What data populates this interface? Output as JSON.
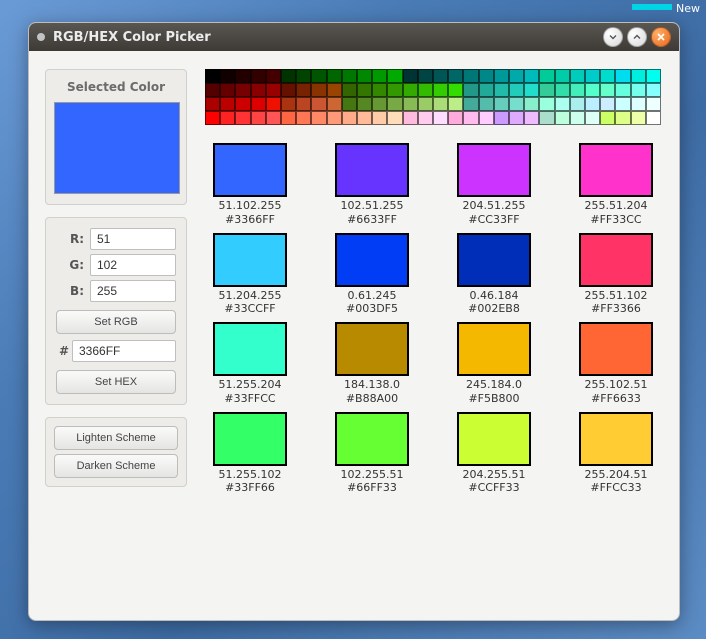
{
  "desktop": {
    "new_label": "New"
  },
  "window": {
    "title": "RGB/HEX Color Picker"
  },
  "left": {
    "selected_header": "Selected Color",
    "selected_hex": "#3366FF",
    "r_label": "R:",
    "g_label": "G:",
    "b_label": "B:",
    "r_value": "51",
    "g_value": "102",
    "b_value": "255",
    "set_rgb": "Set RGB",
    "hex_prefix": "#",
    "hex_value": "3366FF",
    "set_hex": "Set HEX",
    "lighten": "Lighten Scheme",
    "darken": "Darken Scheme"
  },
  "palette_rows": [
    [
      "#000000",
      "#110000",
      "#220000",
      "#330000",
      "#440000",
      "#003300",
      "#004400",
      "#005500",
      "#006600",
      "#007700",
      "#008800",
      "#009900",
      "#00aa00",
      "#003333",
      "#004444",
      "#005555",
      "#006666",
      "#007777",
      "#008888",
      "#009999",
      "#00aaaa",
      "#00bbbb",
      "#00cc99",
      "#00ccaa",
      "#00ccbb",
      "#00cccc",
      "#00ddcc",
      "#00ddee",
      "#00eedd",
      "#00ffee"
    ],
    [
      "#550000",
      "#660000",
      "#770000",
      "#880000",
      "#990000",
      "#661100",
      "#772200",
      "#883300",
      "#994400",
      "#336600",
      "#337700",
      "#338800",
      "#339900",
      "#33aa00",
      "#33bb00",
      "#33cc00",
      "#33dd00",
      "#229988",
      "#22aa99",
      "#22bbaa",
      "#22ccbb",
      "#22ddcc",
      "#33cc99",
      "#33ddaa",
      "#44eebb",
      "#55ffcc",
      "#66ffcc",
      "#66ffdd",
      "#77ffee",
      "#88ffff"
    ],
    [
      "#aa0000",
      "#bb0000",
      "#cc0000",
      "#dd0000",
      "#ee1100",
      "#aa3311",
      "#bb4422",
      "#cc5533",
      "#cc6633",
      "#447711",
      "#558822",
      "#669933",
      "#77aa44",
      "#88bb55",
      "#99cc66",
      "#aadd77",
      "#bbee88",
      "#44aa99",
      "#55bbaa",
      "#66ccbb",
      "#77ddcc",
      "#88eecc",
      "#99ffdd",
      "#aaffee",
      "#aaeeee",
      "#bbeeff",
      "#cceeff",
      "#ccffff",
      "#ddffff",
      "#eeffff"
    ],
    [
      "#ff0000",
      "#ff2222",
      "#ff3333",
      "#ff4444",
      "#ff5555",
      "#ff6644",
      "#ff7755",
      "#ff8866",
      "#ff9977",
      "#ffaa88",
      "#ffbb99",
      "#ffccaa",
      "#ffddbb",
      "#ffbbdd",
      "#ffccee",
      "#ffddff",
      "#ffaadd",
      "#ffbbee",
      "#ffccff",
      "#cc99ff",
      "#ddaaff",
      "#eebbff",
      "#aaddcc",
      "#bbffdd",
      "#ccffee",
      "#ddfff5",
      "#ccff66",
      "#ddff88",
      "#eeffaa",
      "#ffffff"
    ]
  ],
  "swatches": [
    {
      "hex": "#3366FF",
      "rgb": "51.102.255"
    },
    {
      "hex": "#6633FF",
      "rgb": "102.51.255"
    },
    {
      "hex": "#CC33FF",
      "rgb": "204.51.255"
    },
    {
      "hex": "#FF33CC",
      "rgb": "255.51.204"
    },
    {
      "hex": "#33CCFF",
      "rgb": "51.204.255"
    },
    {
      "hex": "#003DF5",
      "rgb": "0.61.245"
    },
    {
      "hex": "#002EB8",
      "rgb": "0.46.184"
    },
    {
      "hex": "#FF3366",
      "rgb": "255.51.102"
    },
    {
      "hex": "#33FFCC",
      "rgb": "51.255.204"
    },
    {
      "hex": "#B88A00",
      "rgb": "184.138.0"
    },
    {
      "hex": "#F5B800",
      "rgb": "245.184.0"
    },
    {
      "hex": "#FF6633",
      "rgb": "255.102.51"
    },
    {
      "hex": "#33FF66",
      "rgb": "51.255.102"
    },
    {
      "hex": "#66FF33",
      "rgb": "102.255.51"
    },
    {
      "hex": "#CCFF33",
      "rgb": "204.255.51"
    },
    {
      "hex": "#FFCC33",
      "rgb": "255.204.51"
    }
  ]
}
